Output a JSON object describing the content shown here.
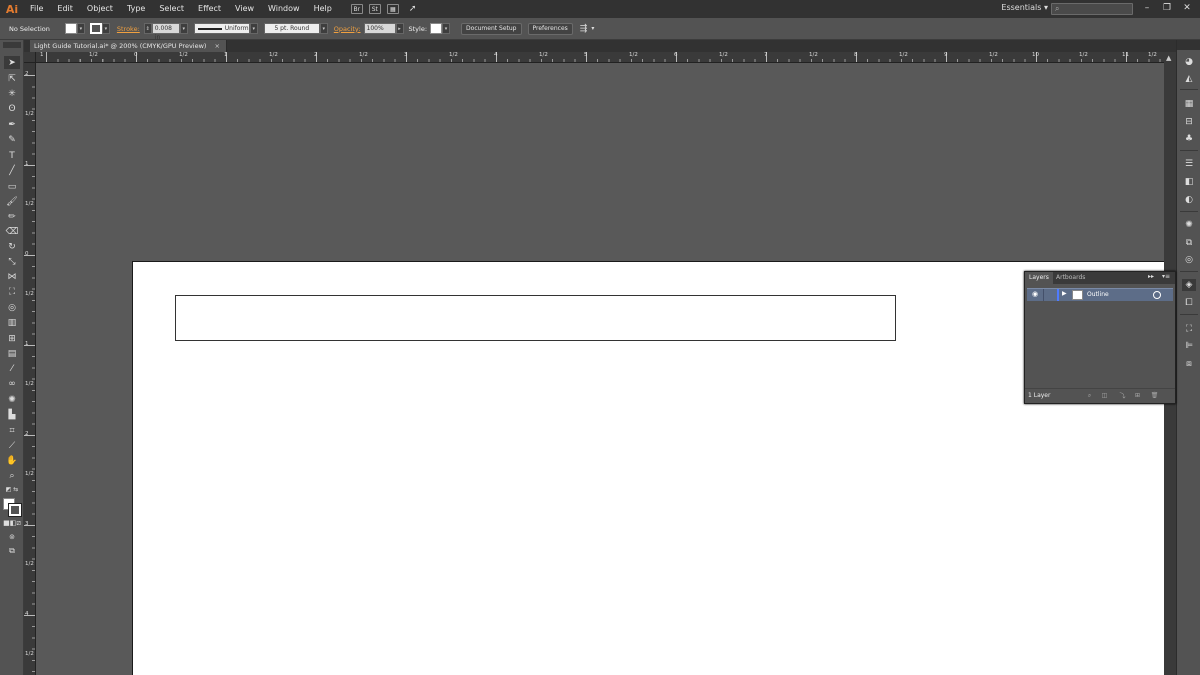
{
  "app": {
    "logo": "Ai"
  },
  "menu": {
    "items": [
      "File",
      "Edit",
      "Object",
      "Type",
      "Select",
      "Effect",
      "View",
      "Window",
      "Help"
    ],
    "bridge_labels": [
      "Br",
      "St"
    ],
    "workspace": "Essentials",
    "search_placeholder": "",
    "window_controls": {
      "minimize": "–",
      "restore": "❐",
      "close": "✕"
    }
  },
  "control_bar": {
    "selection": "No Selection",
    "stroke_label": "Stroke:",
    "stroke_weight": "0.008 in",
    "profile": "Uniform",
    "brush": "5 pt. Round",
    "opacity_label": "Opacity:",
    "opacity_value": "100%",
    "style_label": "Style:",
    "document_setup": "Document Setup",
    "preferences": "Preferences"
  },
  "document": {
    "tab_title": "Light Guide Tutorial.ai* @ 200% (CMYK/GPU Preview)",
    "tab_close": "×"
  },
  "rulers": {
    "h_labels": [
      "1",
      "1/2",
      "0",
      "1/2",
      "1",
      "1/2",
      "2",
      "1/2",
      "3",
      "1/2",
      "4",
      "1/2",
      "5",
      "1/2",
      "6",
      "1/2",
      "7",
      "1/2",
      "8",
      "1/2",
      "9",
      "1/2",
      "10",
      "1/2",
      "11",
      "1/2"
    ],
    "v_labels": [
      "2",
      "1/2",
      "1",
      "1/2",
      "0",
      "1/2",
      "1",
      "1/2",
      "2",
      "1/2",
      "3",
      "1/2",
      "4",
      "1/2"
    ]
  },
  "layers_panel": {
    "tabs": [
      "Layers",
      "Artboards"
    ],
    "collapse": "▸▸",
    "menu": "▾≡",
    "layer_name": "Outline",
    "count": "1 Layer"
  },
  "colors": {
    "ui_dark": "#323232",
    "ui_mid": "#535353",
    "canvas": "#595959",
    "accent_orange": "#e37b2f",
    "layer_highlight": "#5d6d88"
  }
}
